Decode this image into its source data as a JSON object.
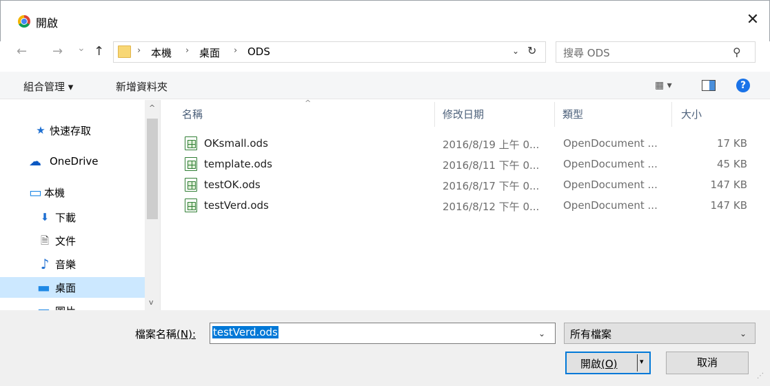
{
  "window": {
    "title": "開啟",
    "close": "✕"
  },
  "nav": {
    "back": "←",
    "forward": "→",
    "recent": "⌄",
    "up": "↑",
    "breadcrumb": [
      "本機",
      "桌面",
      "ODS"
    ],
    "separator": "›",
    "dropdown": "⌄",
    "refresh": "↻"
  },
  "search": {
    "placeholder": "搜尋 ODS",
    "icon": "⚲"
  },
  "toolbar": {
    "organize": "組合管理 ▾",
    "new_folder": "新增資料夾",
    "view": "▦ ▾",
    "help": "?"
  },
  "sidebar": {
    "items": [
      {
        "label": "快速存取",
        "icon": "star-icon",
        "glyph": "★",
        "color": "#1e6fd1"
      },
      {
        "label": "OneDrive",
        "icon": "cloud-icon",
        "glyph": "☁",
        "color": "#0b58c2"
      },
      {
        "label": "本機",
        "icon": "computer-icon",
        "glyph": "▭",
        "color": "#1e88e5"
      },
      {
        "label": "下載",
        "icon": "download-icon",
        "glyph": "⬇",
        "color": "#1e6fd1"
      },
      {
        "label": "文件",
        "icon": "document-icon",
        "glyph": "🗎",
        "color": "#555555"
      },
      {
        "label": "音樂",
        "icon": "music-icon",
        "glyph": "♪",
        "color": "#1e6fd1"
      },
      {
        "label": "桌面",
        "icon": "desktop-icon",
        "glyph": "▬",
        "color": "#1e88e5"
      },
      {
        "label": "圖片",
        "icon": "pictures-icon",
        "glyph": "▭",
        "color": "#1e88e5"
      }
    ],
    "scroll_up": "^",
    "scroll_down": "v"
  },
  "columns": {
    "name": "名稱",
    "modified": "修改日期",
    "type": "類型",
    "size": "大小",
    "sort": "^"
  },
  "files": [
    {
      "name": "OKsmall.ods",
      "modified": "2016/8/19 上午 0...",
      "type": "OpenDocument ...",
      "size": "17 KB"
    },
    {
      "name": "template.ods",
      "modified": "2016/8/11 下午 0...",
      "type": "OpenDocument ...",
      "size": "45 KB"
    },
    {
      "name": "testOK.ods",
      "modified": "2016/8/17 下午 0...",
      "type": "OpenDocument ...",
      "size": "147 KB"
    },
    {
      "name": "testVerd.ods",
      "modified": "2016/8/12 下午 0...",
      "type": "OpenDocument ...",
      "size": "147 KB"
    }
  ],
  "footer": {
    "filename_label": "檔案名稱",
    "filename_key": "(N):",
    "filename_value": "testVerd.ods",
    "dropdown": "⌄",
    "filetype_value": "所有檔案",
    "open_label": "開啟",
    "open_key": "(O)",
    "open_caret": "▾",
    "cancel_label": "取消",
    "grip": "⋰"
  },
  "colors": {
    "accent": "#0078d7",
    "selected_row": "#cce8ff",
    "ods_green": "#2e7d32"
  }
}
